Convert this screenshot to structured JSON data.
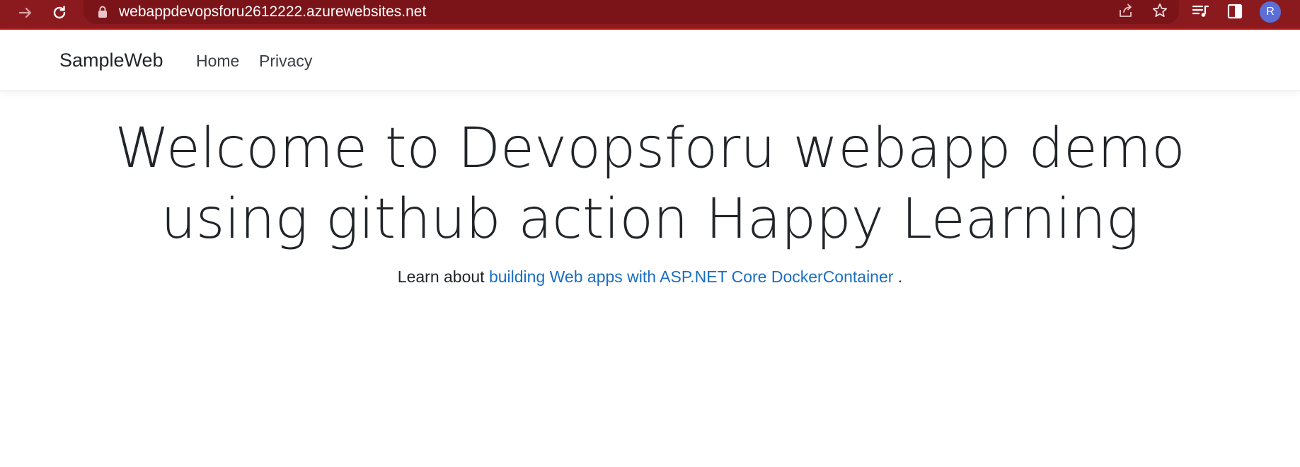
{
  "browser": {
    "url": "webappdevopsforu2612222.azurewebsites.net",
    "avatar_letter": "R",
    "icons": {
      "forward": "arrow-right-icon",
      "reload": "reload-icon",
      "lock": "lock-icon",
      "share": "share-icon",
      "bookmark": "star-icon",
      "reading_list": "reading-list-icon",
      "side_panel": "side-panel-icon"
    },
    "colors": {
      "frame": "#8b1a1f",
      "omnibox": "#7a1419",
      "avatar": "#5b6fd6"
    }
  },
  "navbar": {
    "brand": "SampleWeb",
    "links": [
      {
        "label": "Home"
      },
      {
        "label": "Privacy"
      }
    ]
  },
  "main": {
    "title": "Welcome to Devopsforu webapp demo using github action Happy Learning",
    "lead_prefix": "Learn about",
    "lead_link": "building Web apps with ASP.NET Core DockerContainer",
    "lead_suffix": ".",
    "link_color": "#1b6ec2"
  }
}
